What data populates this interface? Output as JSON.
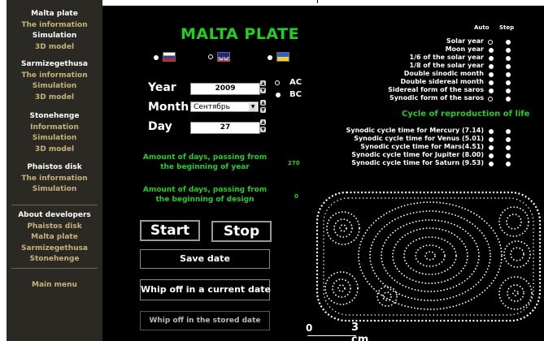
{
  "sidebar": {
    "groups": [
      {
        "title": "Malta plate",
        "items": [
          "The information",
          "Simulation",
          "3D model"
        ]
      },
      {
        "title": "Sarmizegethusa",
        "items": [
          "The information",
          "Simulation",
          "3D model"
        ]
      },
      {
        "title": "Stonehenge",
        "items": [
          "Information",
          "Simulation",
          "3D model"
        ]
      },
      {
        "title": "Phaistos disk",
        "items": [
          "The information",
          "Simulation"
        ]
      }
    ],
    "about": {
      "title": "About developers",
      "items": [
        "Phaistos disk",
        "Malta plate",
        "Sarmizegethusa",
        "Stonehenge"
      ]
    },
    "main_menu": "Main menu"
  },
  "main": {
    "title": "MALTA PLATE",
    "languages": [
      "ru",
      "uk",
      "ua"
    ],
    "date": {
      "year_label": "Year",
      "year_value": "2009",
      "month_label": "Month",
      "month_value": "Сентябрь",
      "day_label": "Day",
      "day_value": "27",
      "era_ac": "AC",
      "era_bc": "BC"
    },
    "days_year_label": "Amount of days, passing from the beginning of year",
    "days_year_value": "270",
    "days_design_label": "Amount of days, passing from the beginning of design",
    "days_design_value": "0",
    "buttons": {
      "start": "Start",
      "stop": "Stop",
      "save": "Save date",
      "whip_current": "Whip off in a current date",
      "whip_stored": "Whip off in the stored date"
    },
    "col_auto": "Auto",
    "col_step": "Step",
    "cycles": [
      "Solar year",
      "Moon year",
      "1/6 of the solar year",
      "1/8 of the solar year",
      "Double sinodic month",
      "Double sidereal month",
      "Sidereal form of the saros",
      "Synodic form of the saros"
    ],
    "life_title": "Cycle of reproduction of life",
    "synodic": [
      "Synodic cycle time for Mercury (7.14)",
      "Synodic cycle time for Venus  (5.01)",
      "Synodic cycle time for  Mars(4.51)",
      "Synodic cycle time for Jupiter (8.00)",
      "Synodic cycle time for  Saturn (9.53)"
    ],
    "scale": {
      "zero": "0",
      "three": "3 cm"
    }
  }
}
